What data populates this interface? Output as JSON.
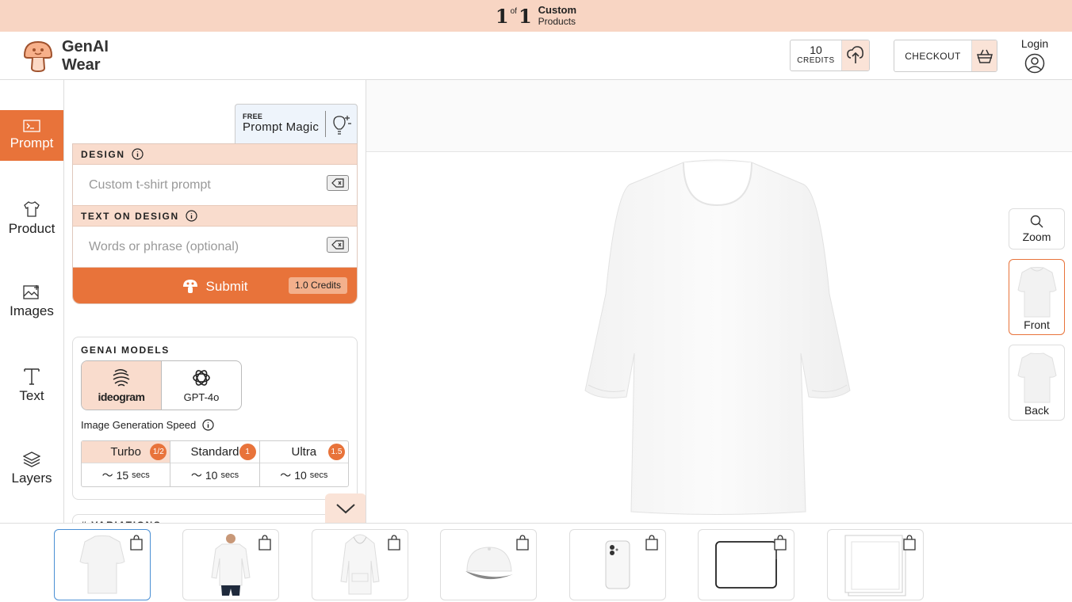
{
  "banner": {
    "of": "of",
    "title": "Custom",
    "subtitle": "Products"
  },
  "brand": {
    "line1": "GenAI",
    "line2": "Wear"
  },
  "header": {
    "credits_value": "10",
    "credits_label": "CREDITS",
    "checkout_label": "CHECKOUT",
    "login_label": "Login"
  },
  "sidebar": {
    "items": [
      {
        "label": "Prompt",
        "icon": "terminal-icon"
      },
      {
        "label": "Product",
        "icon": "tshirt-icon"
      },
      {
        "label": "Images",
        "icon": "image-icon"
      },
      {
        "label": "Text",
        "icon": "text-icon"
      },
      {
        "label": "Layers",
        "icon": "layers-icon"
      }
    ]
  },
  "prompt_magic": {
    "badge": "FREE",
    "label": "Prompt Magic"
  },
  "design": {
    "heading": "DESIGN",
    "placeholder": "Custom t-shirt prompt",
    "value": ""
  },
  "text_on_design": {
    "heading": "TEXT ON DESIGN",
    "placeholder": "Words or phrase (optional)",
    "value": ""
  },
  "submit": {
    "label": "Submit",
    "cost": "1.0  Credits"
  },
  "models": {
    "heading": "GENAI MODELS",
    "options": [
      {
        "label": "ideogram",
        "selected": true
      },
      {
        "label": "GPT-4o",
        "selected": false
      }
    ],
    "speed_label": "Image Generation Speed",
    "speeds": [
      {
        "name": "Turbo",
        "badge": "1/2",
        "time": "15",
        "unit": "secs",
        "selected": true
      },
      {
        "name": "Standard",
        "badge": "1",
        "time": "10",
        "unit": "secs",
        "selected": false
      },
      {
        "name": "Ultra",
        "badge": "1.5",
        "time": "10",
        "unit": "secs",
        "selected": false
      }
    ]
  },
  "variations_heading": "# VARIATIONS",
  "view": {
    "zoom": "Zoom",
    "front": "Front",
    "back": "Back",
    "selected": "Front"
  },
  "products": [
    "t-shirt",
    "long-sleeve",
    "hoodie",
    "cap",
    "phone-case",
    "laptop-sleeve",
    "poster"
  ],
  "colors": {
    "accent": "#e8733a",
    "accent_light": "#f9dccd",
    "banner": "#f8d5c3",
    "selected_card": "#4a8fd4"
  }
}
